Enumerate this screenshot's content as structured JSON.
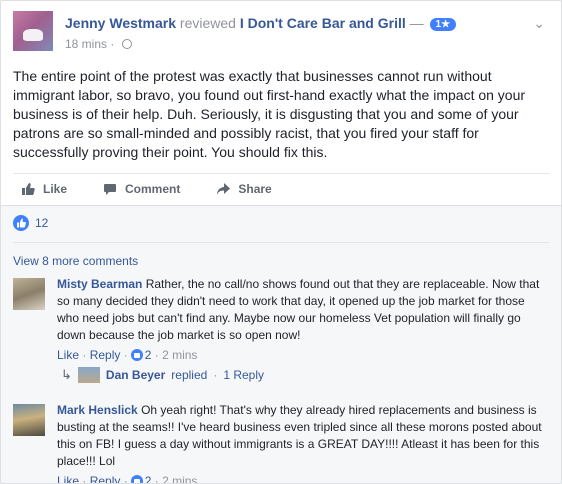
{
  "post": {
    "author": "Jenny Westmark",
    "verb": "reviewed",
    "page": "I Don't Care Bar and Grill",
    "dash": "—",
    "rating": "1★",
    "time": "18 mins",
    "dot": "·",
    "text": "The entire point of the protest was exactly that businesses cannot run without immigrant labor, so bravo, you found out first-hand exactly what the impact on your business is of their help. Duh. Seriously, it is disgusting that you and some of your patrons are so small-minded and possibly racist, that you fired your staff for successfully proving their point. You should fix this."
  },
  "actions": {
    "like": "Like",
    "comment": "Comment",
    "share": "Share"
  },
  "reactions": {
    "count": "12"
  },
  "view_more": "View 8 more comments",
  "comments": [
    {
      "name": "Misty Bearman",
      "text": "Rather, the no call/no shows found out that they are replaceable. Now that so many decided they didn't need to work that day, it opened up the job market for those who need jobs but can't find any. Maybe now our homeless Vet population will finally go down because the job market is so open now!",
      "like": "Like",
      "reply": "Reply",
      "likes": "2",
      "time": "2 mins"
    },
    {
      "name": "Mark Henslick",
      "text": "Oh yeah right! That's why they already hired replacements and business is busting at the seams!! I've heard business even tripled since all these morons posted about this on FB! I guess a day without immigrants is a GREAT DAY!!!! Atleast it has been for this place!!! Lol",
      "like": "Like",
      "reply": "Reply",
      "likes": "2",
      "time": "2 mins"
    }
  ],
  "reply_summary": {
    "name": "Dan Beyer",
    "verb": "replied",
    "count_text": "1 Reply"
  },
  "colors": {
    "link": "#365899",
    "meta": "#90949c",
    "accent": "#4080ff"
  }
}
